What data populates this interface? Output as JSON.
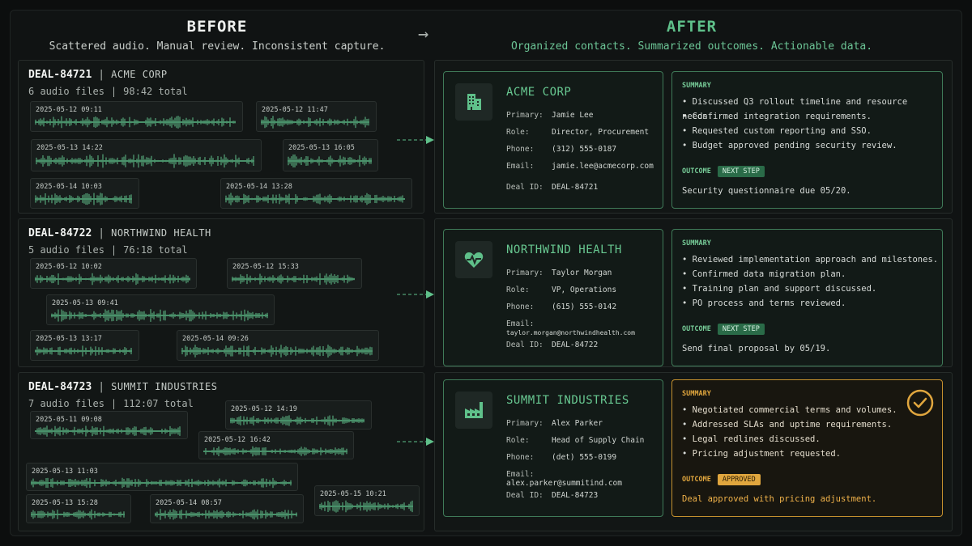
{
  "before": {
    "title": "BEFORE",
    "subtitle": "Scattered audio. Manual review. Inconsistent capture."
  },
  "after": {
    "title": "AFTER",
    "subtitle": "Organized contacts. Summarized outcomes. Actionable data."
  },
  "arrow_icon": "right-arrow-icon",
  "deals": [
    {
      "id": "DEAL-84721",
      "company": "ACME CORP",
      "files": "6 audio files",
      "total": "98:42 total",
      "clips": [
        "2025-05-12 09:11",
        "2025-05-12 11:47",
        "2025-05-13 14:22",
        "2025-05-13 16:05",
        "2025-05-14 10:03",
        "2025-05-14 13:28"
      ]
    },
    {
      "id": "DEAL-84722",
      "company": "NORTHWIND HEALTH",
      "files": "5 audio files",
      "total": "76:18 total",
      "clips": [
        "2025-05-12 10:02",
        "2025-05-12 15:33",
        "2025-05-13 09:41",
        "2025-05-13 13:17",
        "2025-05-14 09:26"
      ]
    },
    {
      "id": "DEAL-84723",
      "company": "SUMMIT INDUSTRIES",
      "files": "7 audio files",
      "total": "112:07 total",
      "clips": [
        "2025-05-11 09:08",
        "2025-05-12 14:19",
        "2025-05-12 16:42",
        "2025-05-13 11:03",
        "2025-05-13 15:28",
        "2025-05-14 08:57",
        "2025-05-15 10:21"
      ]
    }
  ],
  "labels": {
    "primary": "Primary:",
    "role": "Role:",
    "phone": "Phone:",
    "email": "Email:",
    "deal_id": "Deal ID:",
    "summary": "SUMMARY",
    "outcome": "OUTCOME"
  },
  "cards": [
    {
      "company": "ACME CORP",
      "icon": "building-icon",
      "primary": "Jamie Lee",
      "role": "Director, Procurement",
      "phone": "(312) 555-0187",
      "email": "jamie.lee@acmecorp.com",
      "deal_id": "DEAL-84721",
      "summary": [
        "Discussed Q3 rollout timeline and resource needs.",
        "Confirmed integration requirements.",
        "Requested custom reporting and SSO.",
        "Budget approved pending security review."
      ],
      "outcome_badge": "NEXT STEP",
      "outcome_text": "Security questionnaire due 05/20.",
      "accent": "#3f7a58"
    },
    {
      "company": "NORTHWIND HEALTH",
      "icon": "heart-pulse-icon",
      "primary": "Taylor Morgan",
      "role": "VP, Operations",
      "phone": "(615) 555-0142",
      "email": "taylor.morgan@northwindhealth.com",
      "deal_id": "DEAL-84722",
      "summary": [
        "Reviewed implementation approach and milestones.",
        "Confirmed data migration plan.",
        "Training plan and support discussed.",
        "PO process and terms reviewed."
      ],
      "outcome_badge": "NEXT STEP",
      "outcome_text": "Send final proposal by 05/19.",
      "accent": "#3f7a58"
    },
    {
      "company": "SUMMIT INDUSTRIES",
      "icon": "factory-icon",
      "primary": "Alex Parker",
      "role": "Head of Supply Chain",
      "phone": "(det) 555-0199",
      "email": "alex.parker@summitind.com",
      "deal_id": "DEAL-84723",
      "summary": [
        "Negotiated commercial terms and volumes.",
        "Addressed SLAs and uptime requirements.",
        "Legal redlines discussed.",
        "Pricing adjustment requested."
      ],
      "outcome_badge": "APPROVED",
      "outcome_text": "Deal approved with pricing adjustment.",
      "accent": "#c4902e",
      "status_icon": "check-circle-icon"
    }
  ],
  "colors": {
    "green": "#5fc08a",
    "gold": "#e0a63e",
    "background": "#0c0e0e"
  }
}
